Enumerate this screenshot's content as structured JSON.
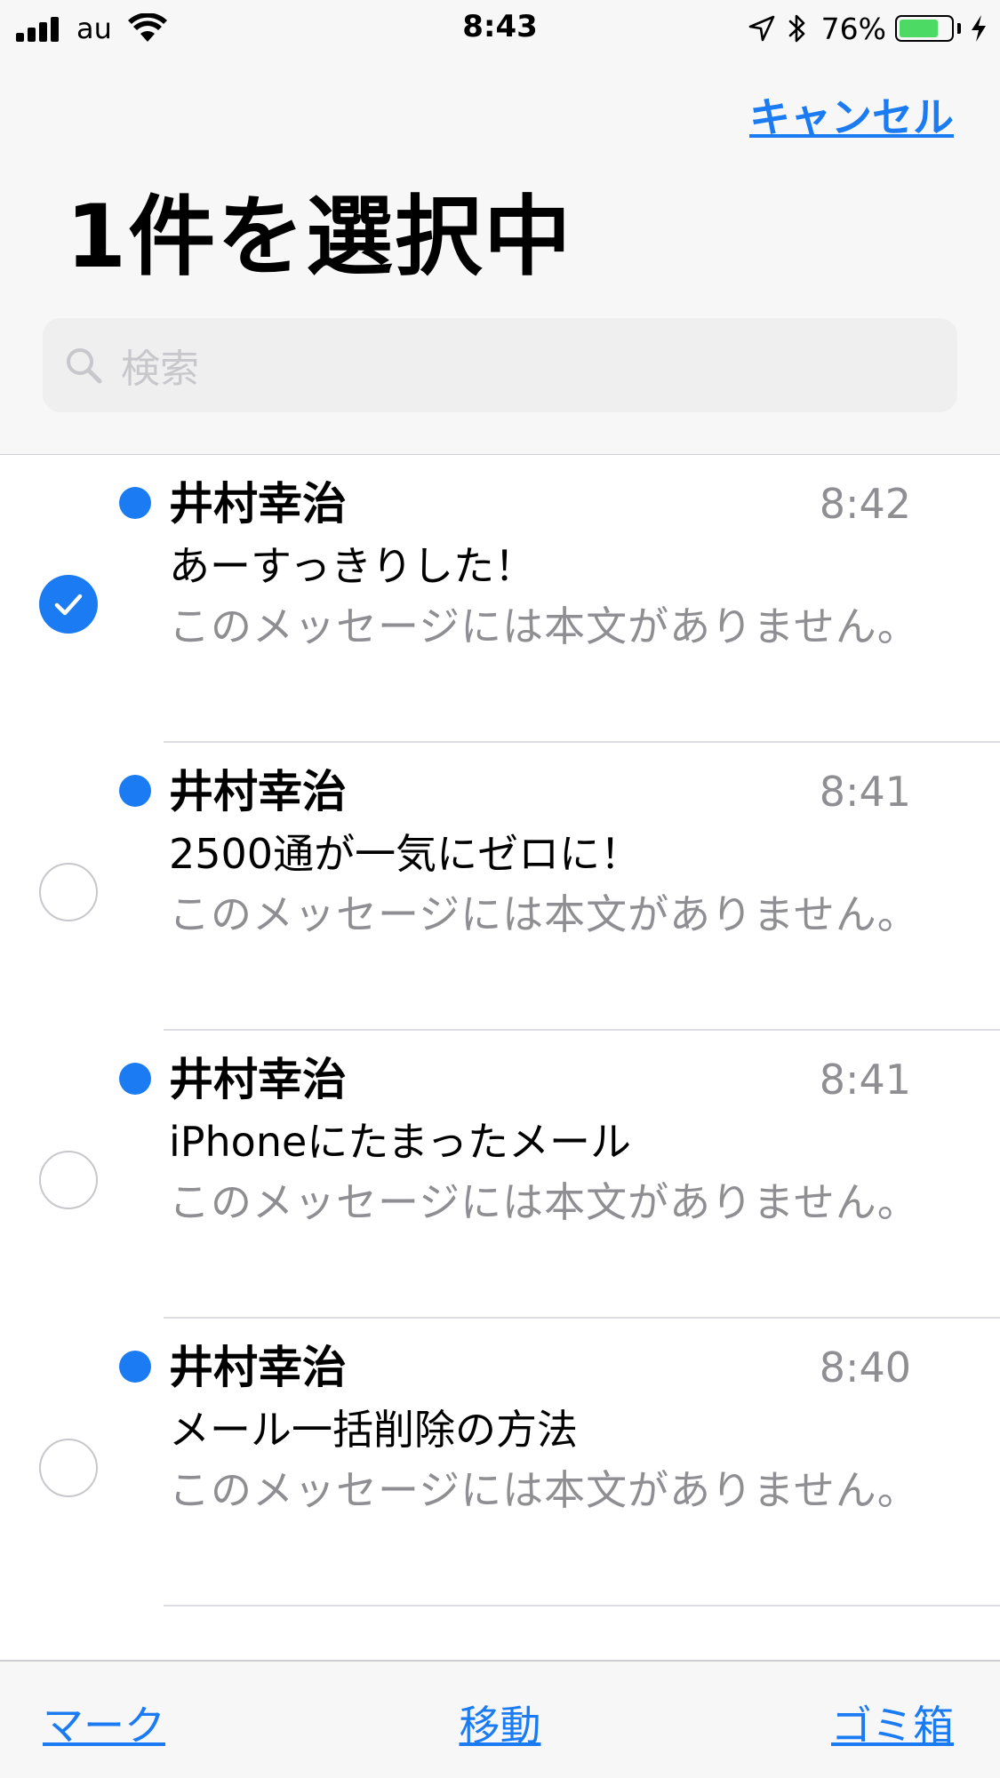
{
  "status_bar": {
    "carrier": "au",
    "time": "8:43",
    "battery_percent": "76%",
    "battery_level": 0.76,
    "icons": [
      "signal-bars-icon",
      "wifi-icon",
      "location-arrow-icon",
      "bluetooth-icon",
      "battery-icon",
      "charging-bolt-icon"
    ]
  },
  "nav": {
    "cancel_label": "キャンセル",
    "title": "1件を選択中"
  },
  "search": {
    "placeholder": "検索",
    "icon": "search-icon"
  },
  "messages": [
    {
      "sender": "井村幸治",
      "time": "8:42",
      "subject": "あーすっきりした！",
      "preview": "このメッセージには本文がありません。",
      "unread": true,
      "selected": true
    },
    {
      "sender": "井村幸治",
      "time": "8:41",
      "subject": "2500通が一気にゼロに！",
      "preview": "このメッセージには本文がありません。",
      "unread": true,
      "selected": false
    },
    {
      "sender": "井村幸治",
      "time": "8:41",
      "subject": "iPhoneにたまったメール",
      "preview": "このメッセージには本文がありません。",
      "unread": true,
      "selected": false
    },
    {
      "sender": "井村幸治",
      "time": "8:40",
      "subject": "メール一括削除の方法",
      "preview": "このメッセージには本文がありません。",
      "unread": true,
      "selected": false
    }
  ],
  "toolbar": {
    "mark_label": "マーク",
    "move_label": "移動",
    "trash_label": "ゴミ箱"
  },
  "colors": {
    "accent": "#1a7bf2",
    "battery": "#4cd964",
    "secondary_text": "#8e8e93"
  }
}
